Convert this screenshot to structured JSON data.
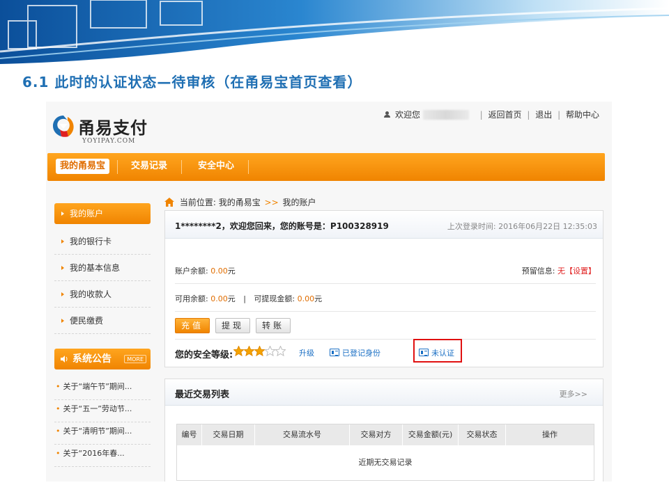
{
  "slide": {
    "title": "6.1  此时的认证状态—待审核（在甬易宝首页查看）"
  },
  "header": {
    "welcome_prefix": "欢迎您",
    "links": [
      "返回首页",
      "退出",
      "帮助中心"
    ],
    "separator": "|"
  },
  "logo": {
    "name": "甬易支付",
    "domain": "YOYIPAY.COM"
  },
  "nav": {
    "items": [
      "我的甬易宝",
      "交易记录",
      "安全中心"
    ],
    "active": "我的甬易宝"
  },
  "sidebar": {
    "items": [
      {
        "label": "我的账户",
        "active": true
      },
      {
        "label": "我的银行卡",
        "active": false
      },
      {
        "label": "我的基本信息",
        "active": false
      },
      {
        "label": "我的收款人",
        "active": false
      },
      {
        "label": "便民缴费",
        "active": false
      }
    ],
    "notice": {
      "title": "系统公告",
      "more": "MORE",
      "items": [
        "关于“端午节”期间...",
        "关于“五一”劳动节...",
        "关于“清明节”期间...",
        "关于“2016年春..."
      ]
    }
  },
  "breadcrumb": {
    "prefix": "当前位置:",
    "level1": "我的甬易宝",
    "arrow": ">>",
    "level2": "我的账户"
  },
  "account": {
    "welcome": "1********2，欢迎您回来，您的账号是：P100328919",
    "last_login_label": "上次登录时间:",
    "last_login_value": "2016年06月22日 12:35:03",
    "balance_label": "账户余额:",
    "balance_value": "0.00",
    "currency": "元",
    "reserve_label": "预留信息:",
    "reserve_value": "无【设置】",
    "available_label": "可用余额:",
    "available_value": "0.00",
    "divider": "|",
    "withdrawable_label": "可提现金额:",
    "withdrawable_value": "0.00",
    "buttons": [
      "充值",
      "提现",
      "转账"
    ],
    "security_label": "您的安全等级:",
    "security_stars": 3,
    "security_max": 5,
    "upgrade_link": "升级",
    "identity_link": "已登记身份",
    "auth_link": "未认证"
  },
  "trades": {
    "title": "最近交易列表",
    "more": "更多>>",
    "columns": [
      "编号",
      "交易日期",
      "交易流水号",
      "交易对方",
      "交易金额(元)",
      "交易状态",
      "操作"
    ],
    "empty": "近期无交易记录"
  },
  "colors": {
    "accent": "#f08400",
    "title_blue": "#1f6fb3",
    "link_blue": "#1a6fc4",
    "highlight_red": "#e01010"
  }
}
